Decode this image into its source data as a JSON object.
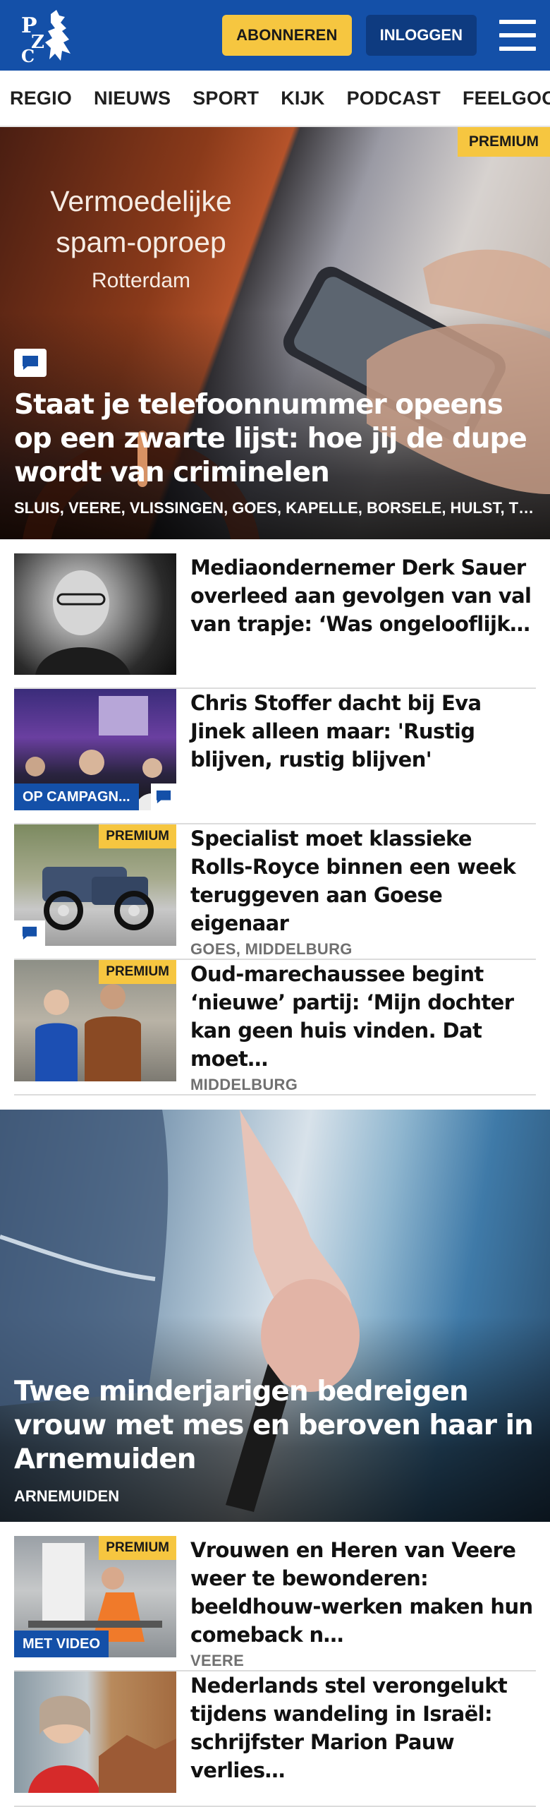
{
  "header": {
    "logo_alt": "PZC",
    "subscribe_label": "ABONNEREN",
    "login_label": "INLOGGEN",
    "colors": {
      "brand": "#1450a8",
      "accent": "#f6c640"
    }
  },
  "nav": {
    "items": [
      "REGIO",
      "NIEUWS",
      "SPORT",
      "KIJK",
      "PODCAST",
      "FEELGOOD"
    ]
  },
  "hero": {
    "image_text": {
      "line1": "Vermoedelijke",
      "line2": "spam-oproep",
      "line3": "Rotterdam"
    },
    "badge": "PREMIUM",
    "title": "Staat je telefoonnummer opeens op een zwarte lijst: hoe jij de dupe wordt van criminelen",
    "tags": "SLUIS, VEERE, VLISSINGEN, GOES, KAPELLE, BORSELE, HULST, TERNEUZEN",
    "icons": [
      "comment-icon"
    ]
  },
  "articles": [
    {
      "title": "Mediaondernemer Derk Sauer overleed aan gevolgen van val van trapje: ‘Was ongelooflijk…",
      "tag": "",
      "badge": "",
      "label": ""
    },
    {
      "title": "Chris Stoffer dacht bij Eva Jinek alleen maar: 'Rustig blijven, rustig blijven'",
      "tag": "",
      "badge": "",
      "label": "OP CAMPAGN..."
    },
    {
      "title": "Specialist moet klassieke Rolls-Royce binnen een week teruggeven aan Goese eigenaar",
      "tag": "GOES, MIDDELBURG",
      "badge": "PREMIUM",
      "label": ""
    },
    {
      "title": "Oud-marechaussee begint ‘nieuwe’ partij: ‘Mijn dochter kan geen huis vinden. Dat moet…",
      "tag": "MIDDELBURG",
      "badge": "PREMIUM",
      "label": ""
    }
  ],
  "hero2": {
    "title": "Twee minderjarigen bedreigen vrouw met mes en beroven haar in Arnemuiden",
    "tags": "ARNEMUIDEN"
  },
  "articles2": [
    {
      "title": "Vrouwen en Heren van Veere weer te bewonderen: beeldhouw-werken maken hun comeback n…",
      "tag": "VEERE",
      "badge": "PREMIUM",
      "label": "MET VIDEO"
    },
    {
      "title": "Nederlands stel verongelukt tijdens wandeling in Israël: schrijfster Marion Pauw verlies…",
      "tag": "",
      "badge": "",
      "label": ""
    }
  ]
}
